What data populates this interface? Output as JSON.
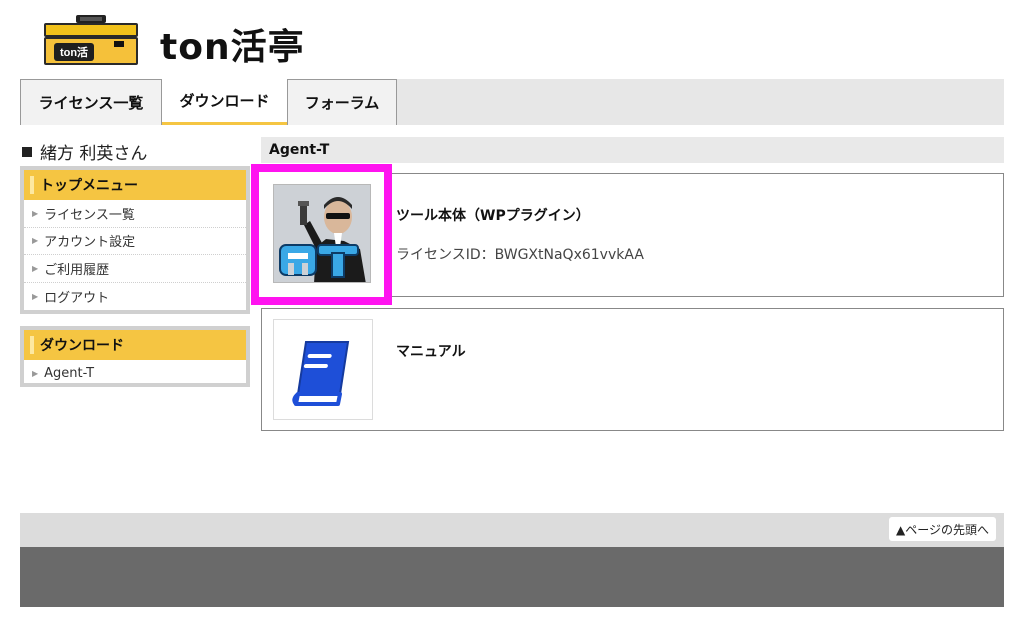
{
  "header": {
    "logo_badge": "ton活",
    "logo_text": "ton活亭"
  },
  "nav": {
    "tabs": [
      {
        "label": "ライセンス一覧"
      },
      {
        "label": "ダウンロード"
      },
      {
        "label": "フォーラム"
      }
    ]
  },
  "user": {
    "name": "緒方 利英さん"
  },
  "sidebar": {
    "top_menu": {
      "title": "トップメニュー",
      "items": [
        {
          "label": "ライセンス一覧"
        },
        {
          "label": "アカウント設定"
        },
        {
          "label": "ご利用履歴"
        },
        {
          "label": "ログアウト"
        }
      ]
    },
    "download_menu": {
      "title": "ダウンロード",
      "items": [
        {
          "label": "Agent-T"
        }
      ]
    }
  },
  "main": {
    "section_title": "Agent-T",
    "cards": [
      {
        "title": "ツール本体（WPプラグイン）",
        "subtitle": "ライセンスID：BWGXtNaQx61vvkAA",
        "icon": "agent-t-thumbnail"
      },
      {
        "title": "マニュアル",
        "icon": "manual-book-icon"
      }
    ]
  },
  "footer": {
    "page_top": "▲ページの先頭へ"
  },
  "colors": {
    "accent": "#f5c542",
    "highlight": "#ff13f0",
    "footer_dark": "#6a6a6a",
    "manual_blue": "#1e4fd8"
  }
}
